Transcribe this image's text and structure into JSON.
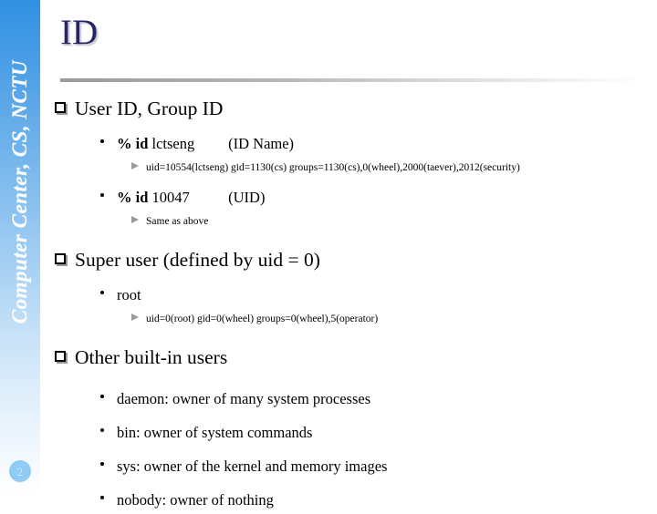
{
  "sidebar": {
    "vertical_text": "Computer Center, CS, NCTU",
    "page_number": "2",
    "gradient_top": "#2f90e2",
    "gradient_bottom": "#fdfeff",
    "badge_color": "#8ecbf5"
  },
  "slide": {
    "title": "ID",
    "title_color": "#262663",
    "sections": [
      {
        "heading": "User ID, Group ID",
        "items": [
          {
            "prompt": "%",
            "command": "id",
            "argument": "lctseng",
            "annotation": "(ID Name)",
            "details": [
              "uid=10554(lctseng) gid=1130(cs) groups=1130(cs),0(wheel),2000(taever),2012(security)"
            ]
          },
          {
            "prompt": "%",
            "command": "id",
            "argument": "10047",
            "annotation": "(UID)",
            "details": [
              "Same as above"
            ]
          }
        ]
      },
      {
        "heading": "Super user (defined by uid = 0)",
        "items": [
          {
            "label": "root",
            "details": [
              "uid=0(root) gid=0(wheel) groups=0(wheel),5(operator)"
            ]
          }
        ]
      },
      {
        "heading": "Other built-in users",
        "items": [
          {
            "label": "daemon: owner of many system processes",
            "details": []
          },
          {
            "label": "bin: owner of system commands",
            "details": []
          },
          {
            "label": "sys: owner of the kernel and memory images",
            "details": []
          },
          {
            "label": "nobody: owner of nothing",
            "details": []
          }
        ]
      }
    ]
  }
}
